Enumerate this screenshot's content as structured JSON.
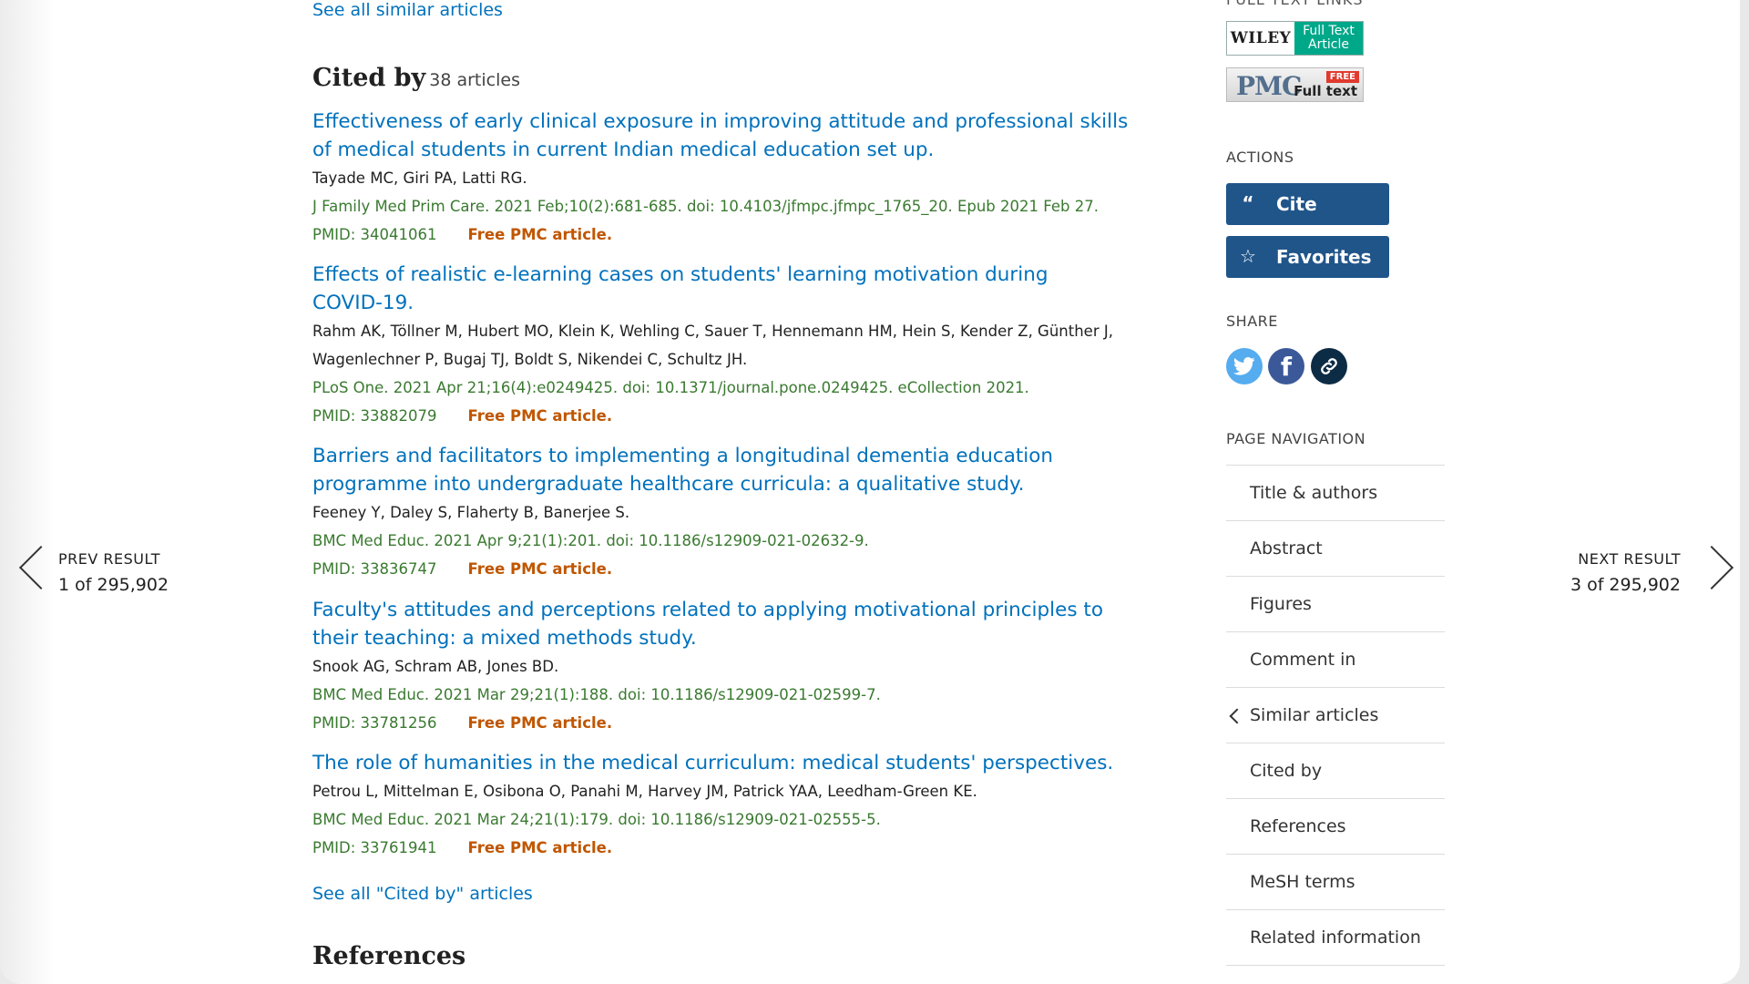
{
  "main": {
    "see_similar": "See all similar articles",
    "cited_by": {
      "title": "Cited by",
      "count": "38 articles",
      "articles": [
        {
          "title": "Effectiveness of early clinical exposure in improving attitude and professional skills of medical students in current Indian medical education set up.",
          "authors": "Tayade MC, Giri PA, Latti RG.",
          "citation": "J Family Med Prim Care. 2021 Feb;10(2):681-685. doi: 10.4103/jfmpc.jfmpc_1765_20. Epub 2021 Feb 27.",
          "pmid": "PMID: 34041061",
          "free": "Free PMC article."
        },
        {
          "title": "Effects of realistic e-learning cases on students' learning motivation during COVID-19.",
          "authors": "Rahm AK, Töllner M, Hubert MO, Klein K, Wehling C, Sauer T, Hennemann HM, Hein S, Kender Z, Günther J, Wagenlechner P, Bugaj TJ, Boldt S, Nikendei C, Schultz JH.",
          "citation": "PLoS One. 2021 Apr 21;16(4):e0249425. doi: 10.1371/journal.pone.0249425. eCollection 2021.",
          "pmid": "PMID: 33882079",
          "free": "Free PMC article."
        },
        {
          "title": "Barriers and facilitators to implementing a longitudinal dementia education programme into undergraduate healthcare curricula: a qualitative study.",
          "authors": "Feeney Y, Daley S, Flaherty B, Banerjee S.",
          "citation": "BMC Med Educ. 2021 Apr 9;21(1):201. doi: 10.1186/s12909-021-02632-9.",
          "pmid": "PMID: 33836747",
          "free": "Free PMC article."
        },
        {
          "title": "Faculty's attitudes and perceptions related to applying motivational principles to their teaching: a mixed methods study.",
          "authors": "Snook AG, Schram AB, Jones BD.",
          "citation": "BMC Med Educ. 2021 Mar 29;21(1):188. doi: 10.1186/s12909-021-02599-7.",
          "pmid": "PMID: 33781256",
          "free": "Free PMC article."
        },
        {
          "title": "The role of humanities in the medical curriculum: medical students' perspectives.",
          "authors": "Petrou L, Mittelman E, Osibona O, Panahi M, Harvey JM, Patrick YAA, Leedham-Green KE.",
          "citation": "BMC Med Educ. 2021 Mar 24;21(1):179. doi: 10.1186/s12909-021-02555-5.",
          "pmid": "PMID: 33761941",
          "free": "Free PMC article."
        }
      ],
      "see_all": "See all \"Cited by\" articles"
    },
    "references_title": "References"
  },
  "pager": {
    "prev_label": "PREV RESULT",
    "prev_count": "1 of 295,902",
    "next_label": "NEXT RESULT",
    "next_count": "3 of 295,902"
  },
  "sidebar": {
    "full_text_links_heading": "FULL TEXT LINKS",
    "wiley": {
      "brand": "WILEY",
      "line1": "Full Text",
      "line2": "Article"
    },
    "pmc": {
      "brand": "PMC",
      "free": "FREE",
      "full_text": "Full text"
    },
    "actions_heading": "ACTIONS",
    "cite_label": "Cite",
    "favorites_label": "Favorites",
    "share_heading": "SHARE",
    "page_nav_heading": "PAGE NAVIGATION",
    "page_nav": [
      "Title & authors",
      "Abstract",
      "Figures",
      "Comment in",
      "Similar articles",
      "Cited by",
      "References",
      "MeSH terms",
      "Related information"
    ]
  },
  "colors": {
    "link": "#0071bc",
    "citation_green": "#3a7a30",
    "free_orange": "#c05600",
    "action_button": "#20558a"
  }
}
